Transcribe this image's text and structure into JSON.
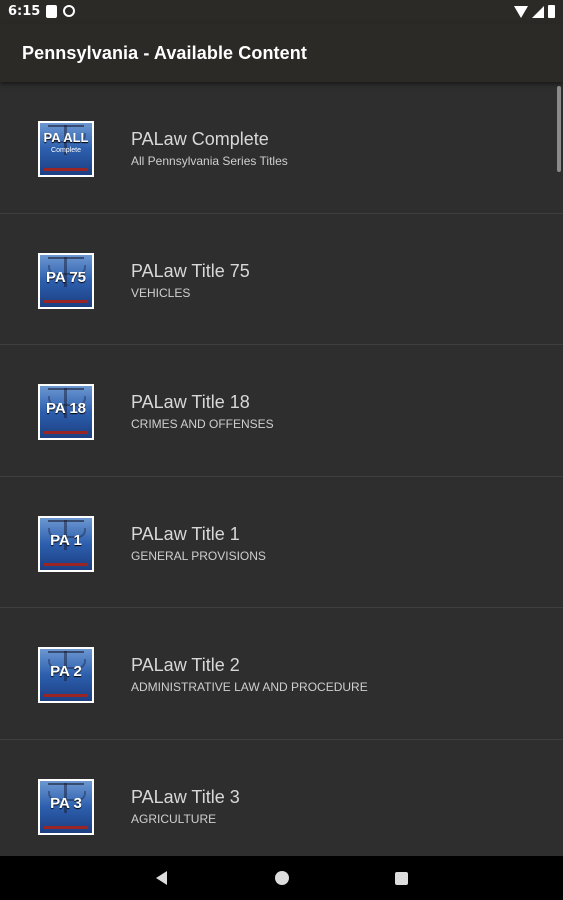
{
  "status_bar": {
    "time": "6:15"
  },
  "app_bar": {
    "title": "Pennsylvania - Available Content"
  },
  "items": [
    {
      "thumb_label": "PA ALL",
      "thumb_sub": "Complete",
      "title": "PALaw Complete",
      "subtitle": "All Pennsylvania Series Titles"
    },
    {
      "thumb_label": "PA 75",
      "thumb_sub": "",
      "title": "PALaw Title 75",
      "subtitle": "VEHICLES"
    },
    {
      "thumb_label": "PA 18",
      "thumb_sub": "",
      "title": "PALaw Title 18",
      "subtitle": "CRIMES AND OFFENSES"
    },
    {
      "thumb_label": "PA 1",
      "thumb_sub": "",
      "title": "PALaw Title 1",
      "subtitle": "GENERAL PROVISIONS"
    },
    {
      "thumb_label": "PA 2",
      "thumb_sub": "",
      "title": "PALaw Title 2",
      "subtitle": "ADMINISTRATIVE LAW AND PROCEDURE"
    },
    {
      "thumb_label": "PA 3",
      "thumb_sub": "",
      "title": "PALaw Title 3",
      "subtitle": "AGRICULTURE"
    }
  ]
}
